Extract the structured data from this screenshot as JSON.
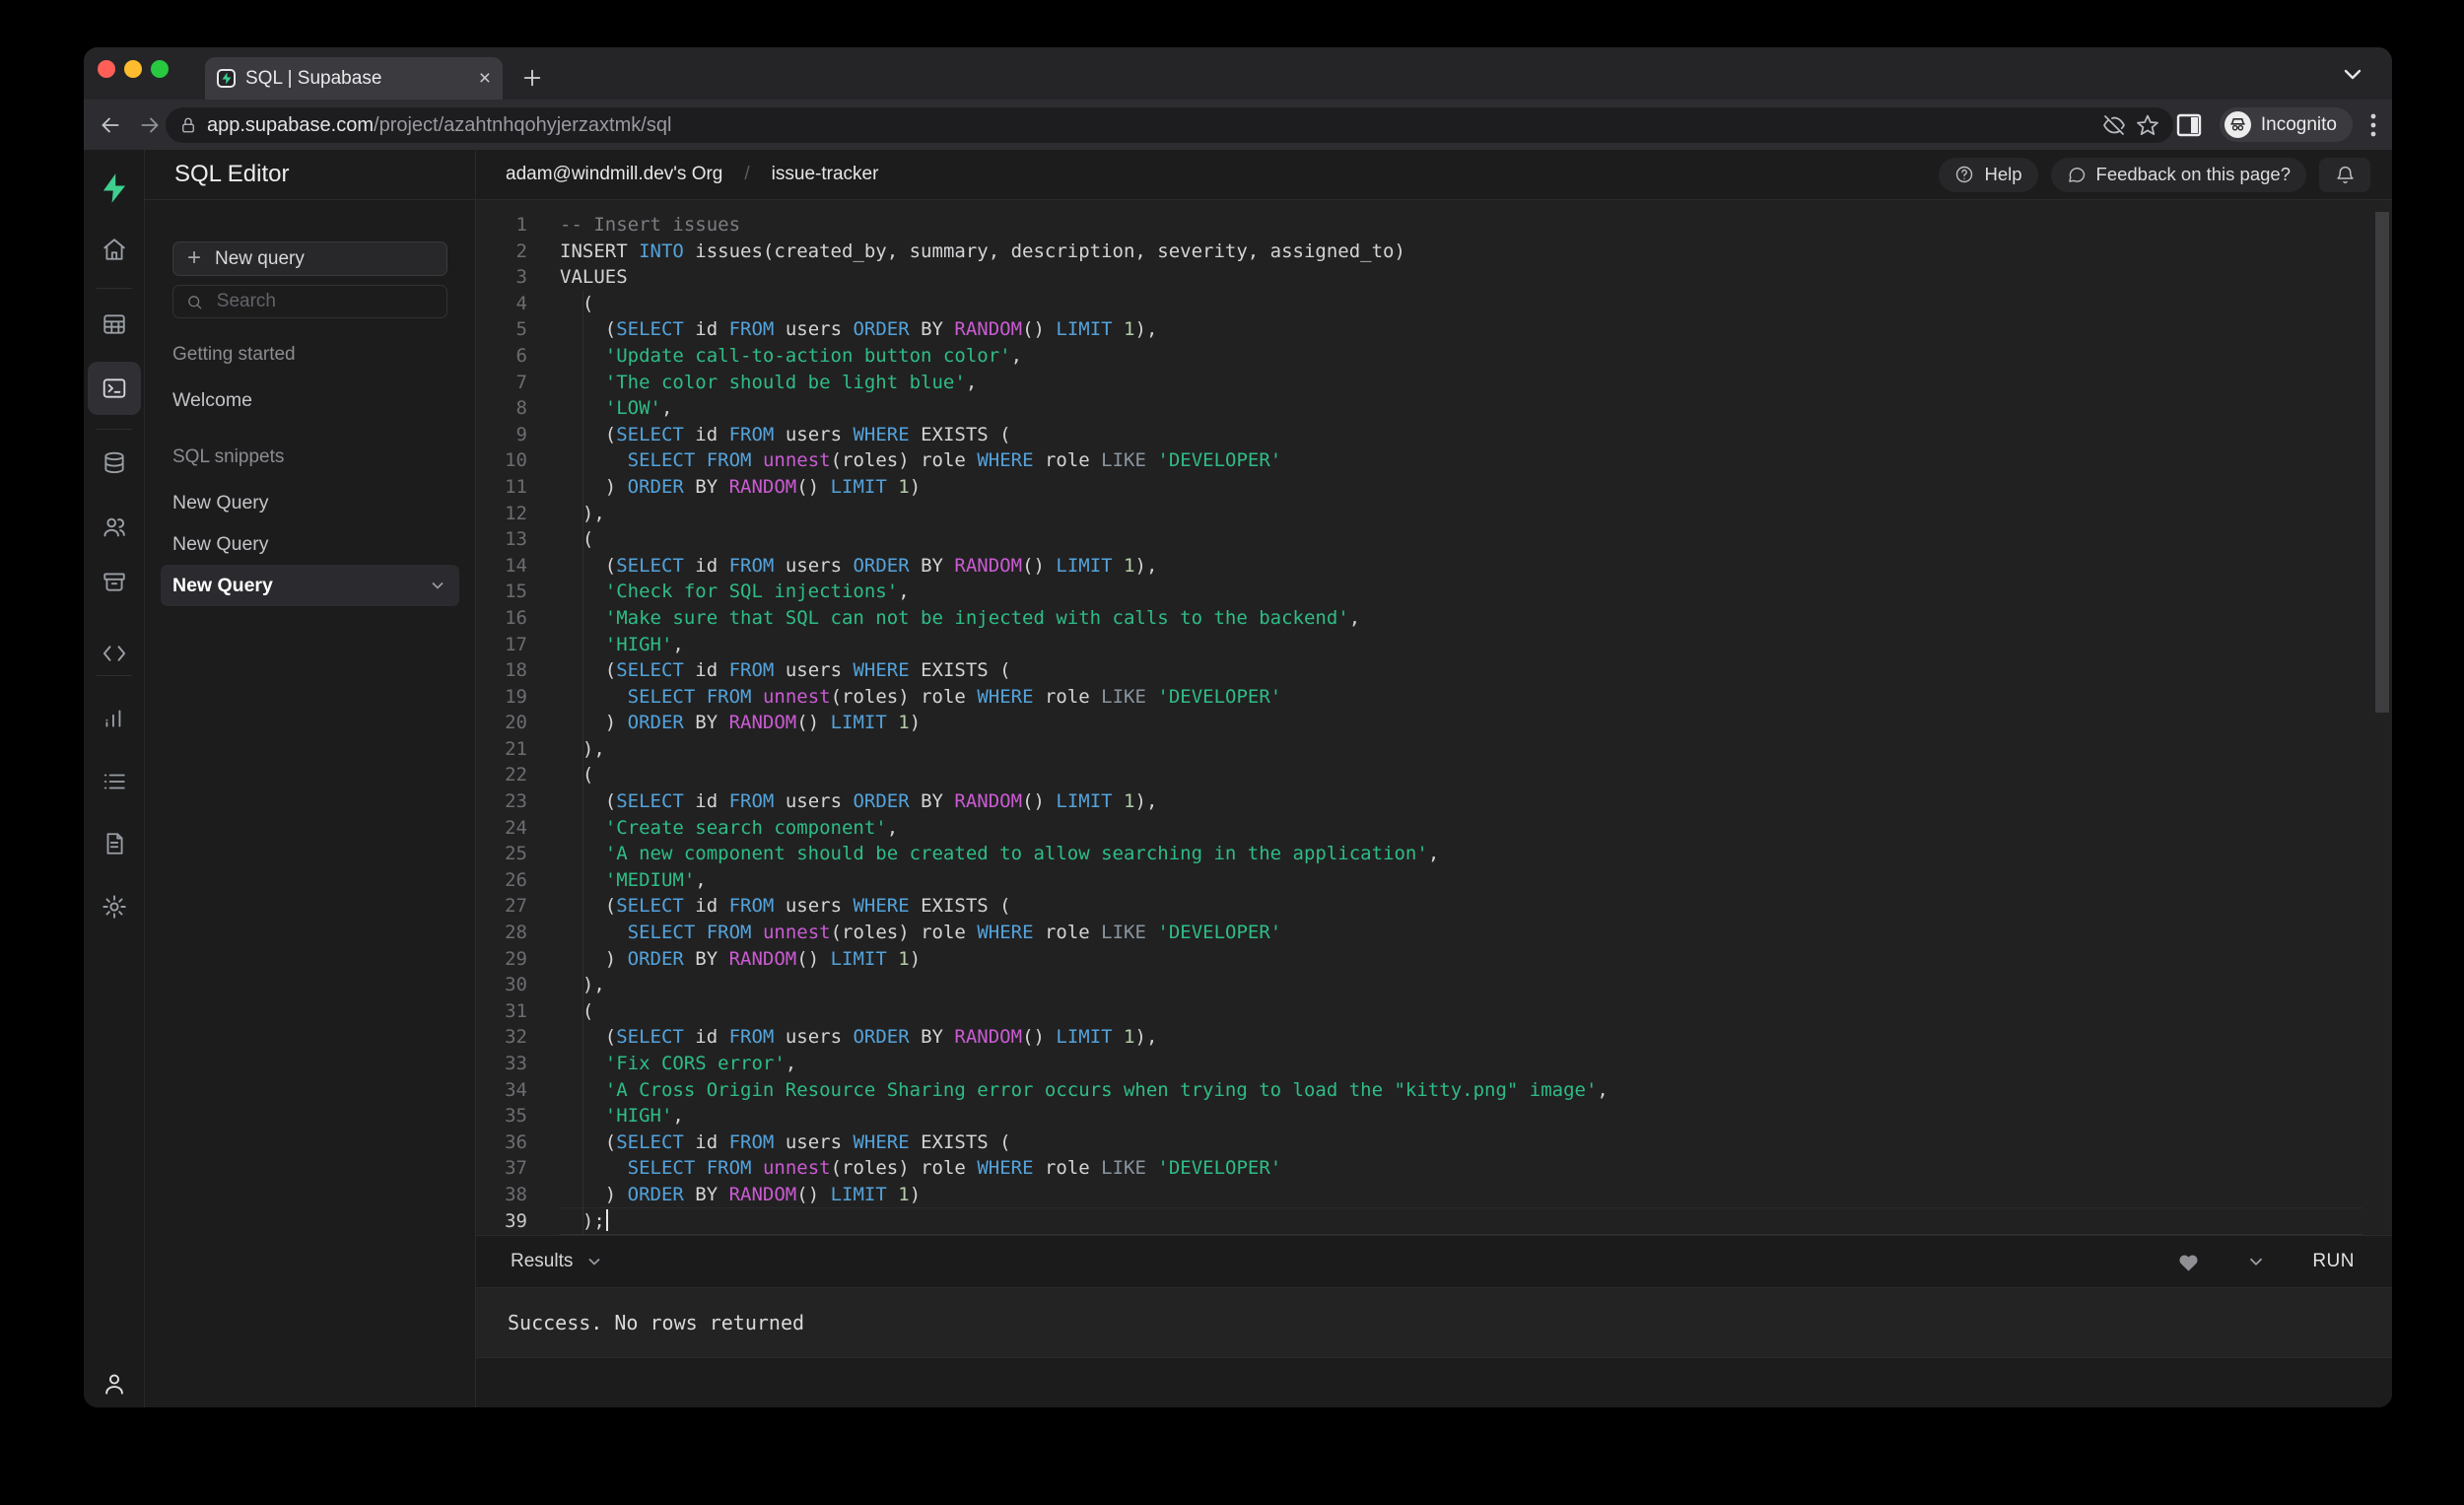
{
  "colors": {
    "accent_green": "#3ECF8E",
    "comment": "#7d7d81",
    "keyword": "#54A3DB",
    "plain": "#d4d4d6",
    "string": "#2EBD85",
    "function": "#CB5BD2",
    "operator": "#8A959E",
    "number": "#B5CEA8"
  },
  "browser": {
    "tab_title": "SQL | Supabase",
    "url_host": "app.supabase.com",
    "url_path": "/project/azahtnhqohyjerzaxtmk/sql",
    "incognito_label": "Incognito"
  },
  "topbar": {
    "breadcrumb_org": "adam@windmill.dev's Org",
    "breadcrumb_sep": "/",
    "breadcrumb_project": "issue-tracker",
    "help_label": "Help",
    "feedback_label": "Feedback on this page?"
  },
  "sidebar": {
    "title": "SQL Editor",
    "new_query_button": "New query",
    "search_placeholder": "Search",
    "sections": [
      {
        "label": "Getting started",
        "items": [
          {
            "label": "Welcome",
            "active": false
          }
        ]
      },
      {
        "label": "SQL snippets",
        "items": [
          {
            "label": "New Query",
            "active": false
          },
          {
            "label": "New Query",
            "active": false
          },
          {
            "label": "New Query",
            "active": true
          }
        ]
      }
    ]
  },
  "results": {
    "panel_label": "Results",
    "run_label": "RUN",
    "message": "Success. No rows returned"
  },
  "editor": {
    "lines": [
      {
        "n": 1,
        "t": [
          [
            "c",
            "-- Insert issues"
          ]
        ]
      },
      {
        "n": 2,
        "t": [
          [
            "p",
            "INSERT "
          ],
          [
            "k",
            "INTO"
          ],
          [
            "p",
            " issues(created_by, summary, description, severity, assigned_to)"
          ]
        ]
      },
      {
        "n": 3,
        "t": [
          [
            "p",
            "VALUES"
          ]
        ]
      },
      {
        "n": 4,
        "t": [
          [
            "p",
            "  ("
          ]
        ]
      },
      {
        "n": 5,
        "t": [
          [
            "p",
            "    ("
          ],
          [
            "k",
            "SELECT"
          ],
          [
            "p",
            " id "
          ],
          [
            "k",
            "FROM"
          ],
          [
            "p",
            " users "
          ],
          [
            "k",
            "ORDER"
          ],
          [
            "p",
            " BY "
          ],
          [
            "f",
            "RANDOM"
          ],
          [
            "p",
            "() "
          ],
          [
            "k",
            "LIMIT"
          ],
          [
            "p",
            " "
          ],
          [
            "n",
            "1"
          ],
          [
            "p",
            "),"
          ]
        ]
      },
      {
        "n": 6,
        "t": [
          [
            "p",
            "    "
          ],
          [
            "s",
            "'Update call-to-action button color'"
          ],
          [
            "p",
            ","
          ]
        ]
      },
      {
        "n": 7,
        "t": [
          [
            "p",
            "    "
          ],
          [
            "s",
            "'The color should be light blue'"
          ],
          [
            "p",
            ","
          ]
        ]
      },
      {
        "n": 8,
        "t": [
          [
            "p",
            "    "
          ],
          [
            "s",
            "'LOW'"
          ],
          [
            "p",
            ","
          ]
        ]
      },
      {
        "n": 9,
        "t": [
          [
            "p",
            "    ("
          ],
          [
            "k",
            "SELECT"
          ],
          [
            "p",
            " id "
          ],
          [
            "k",
            "FROM"
          ],
          [
            "p",
            " users "
          ],
          [
            "k",
            "WHERE"
          ],
          [
            "p",
            " EXISTS ("
          ]
        ]
      },
      {
        "n": 10,
        "t": [
          [
            "p",
            "      "
          ],
          [
            "k",
            "SELECT"
          ],
          [
            "p",
            " "
          ],
          [
            "k",
            "FROM"
          ],
          [
            "p",
            " "
          ],
          [
            "f",
            "unnest"
          ],
          [
            "p",
            "(roles) role "
          ],
          [
            "k",
            "WHERE"
          ],
          [
            "p",
            " role "
          ],
          [
            "o",
            "LIKE"
          ],
          [
            "p",
            " "
          ],
          [
            "s",
            "'DEVELOPER'"
          ]
        ]
      },
      {
        "n": 11,
        "t": [
          [
            "p",
            "    ) "
          ],
          [
            "k",
            "ORDER"
          ],
          [
            "p",
            " BY "
          ],
          [
            "f",
            "RANDOM"
          ],
          [
            "p",
            "() "
          ],
          [
            "k",
            "LIMIT"
          ],
          [
            "p",
            " "
          ],
          [
            "n",
            "1"
          ],
          [
            "p",
            ")"
          ]
        ]
      },
      {
        "n": 12,
        "t": [
          [
            "p",
            "  ),"
          ]
        ]
      },
      {
        "n": 13,
        "t": [
          [
            "p",
            "  ("
          ]
        ]
      },
      {
        "n": 14,
        "t": [
          [
            "p",
            "    ("
          ],
          [
            "k",
            "SELECT"
          ],
          [
            "p",
            " id "
          ],
          [
            "k",
            "FROM"
          ],
          [
            "p",
            " users "
          ],
          [
            "k",
            "ORDER"
          ],
          [
            "p",
            " BY "
          ],
          [
            "f",
            "RANDOM"
          ],
          [
            "p",
            "() "
          ],
          [
            "k",
            "LIMIT"
          ],
          [
            "p",
            " "
          ],
          [
            "n",
            "1"
          ],
          [
            "p",
            "),"
          ]
        ]
      },
      {
        "n": 15,
        "t": [
          [
            "p",
            "    "
          ],
          [
            "s",
            "'Check for SQL injections'"
          ],
          [
            "p",
            ","
          ]
        ]
      },
      {
        "n": 16,
        "t": [
          [
            "p",
            "    "
          ],
          [
            "s",
            "'Make sure that SQL can not be injected with calls to the backend'"
          ],
          [
            "p",
            ","
          ]
        ]
      },
      {
        "n": 17,
        "t": [
          [
            "p",
            "    "
          ],
          [
            "s",
            "'HIGH'"
          ],
          [
            "p",
            ","
          ]
        ]
      },
      {
        "n": 18,
        "t": [
          [
            "p",
            "    ("
          ],
          [
            "k",
            "SELECT"
          ],
          [
            "p",
            " id "
          ],
          [
            "k",
            "FROM"
          ],
          [
            "p",
            " users "
          ],
          [
            "k",
            "WHERE"
          ],
          [
            "p",
            " EXISTS ("
          ]
        ]
      },
      {
        "n": 19,
        "t": [
          [
            "p",
            "      "
          ],
          [
            "k",
            "SELECT"
          ],
          [
            "p",
            " "
          ],
          [
            "k",
            "FROM"
          ],
          [
            "p",
            " "
          ],
          [
            "f",
            "unnest"
          ],
          [
            "p",
            "(roles) role "
          ],
          [
            "k",
            "WHERE"
          ],
          [
            "p",
            " role "
          ],
          [
            "o",
            "LIKE"
          ],
          [
            "p",
            " "
          ],
          [
            "s",
            "'DEVELOPER'"
          ]
        ]
      },
      {
        "n": 20,
        "t": [
          [
            "p",
            "    ) "
          ],
          [
            "k",
            "ORDER"
          ],
          [
            "p",
            " BY "
          ],
          [
            "f",
            "RANDOM"
          ],
          [
            "p",
            "() "
          ],
          [
            "k",
            "LIMIT"
          ],
          [
            "p",
            " "
          ],
          [
            "n",
            "1"
          ],
          [
            "p",
            ")"
          ]
        ]
      },
      {
        "n": 21,
        "t": [
          [
            "p",
            "  ),"
          ]
        ]
      },
      {
        "n": 22,
        "t": [
          [
            "p",
            "  ("
          ]
        ]
      },
      {
        "n": 23,
        "t": [
          [
            "p",
            "    ("
          ],
          [
            "k",
            "SELECT"
          ],
          [
            "p",
            " id "
          ],
          [
            "k",
            "FROM"
          ],
          [
            "p",
            " users "
          ],
          [
            "k",
            "ORDER"
          ],
          [
            "p",
            " BY "
          ],
          [
            "f",
            "RANDOM"
          ],
          [
            "p",
            "() "
          ],
          [
            "k",
            "LIMIT"
          ],
          [
            "p",
            " "
          ],
          [
            "n",
            "1"
          ],
          [
            "p",
            "),"
          ]
        ]
      },
      {
        "n": 24,
        "t": [
          [
            "p",
            "    "
          ],
          [
            "s",
            "'Create search component'"
          ],
          [
            "p",
            ","
          ]
        ]
      },
      {
        "n": 25,
        "t": [
          [
            "p",
            "    "
          ],
          [
            "s",
            "'A new component should be created to allow searching in the application'"
          ],
          [
            "p",
            ","
          ]
        ]
      },
      {
        "n": 26,
        "t": [
          [
            "p",
            "    "
          ],
          [
            "s",
            "'MEDIUM'"
          ],
          [
            "p",
            ","
          ]
        ]
      },
      {
        "n": 27,
        "t": [
          [
            "p",
            "    ("
          ],
          [
            "k",
            "SELECT"
          ],
          [
            "p",
            " id "
          ],
          [
            "k",
            "FROM"
          ],
          [
            "p",
            " users "
          ],
          [
            "k",
            "WHERE"
          ],
          [
            "p",
            " EXISTS ("
          ]
        ]
      },
      {
        "n": 28,
        "t": [
          [
            "p",
            "      "
          ],
          [
            "k",
            "SELECT"
          ],
          [
            "p",
            " "
          ],
          [
            "k",
            "FROM"
          ],
          [
            "p",
            " "
          ],
          [
            "f",
            "unnest"
          ],
          [
            "p",
            "(roles) role "
          ],
          [
            "k",
            "WHERE"
          ],
          [
            "p",
            " role "
          ],
          [
            "o",
            "LIKE"
          ],
          [
            "p",
            " "
          ],
          [
            "s",
            "'DEVELOPER'"
          ]
        ]
      },
      {
        "n": 29,
        "t": [
          [
            "p",
            "    ) "
          ],
          [
            "k",
            "ORDER"
          ],
          [
            "p",
            " BY "
          ],
          [
            "f",
            "RANDOM"
          ],
          [
            "p",
            "() "
          ],
          [
            "k",
            "LIMIT"
          ],
          [
            "p",
            " "
          ],
          [
            "n",
            "1"
          ],
          [
            "p",
            ")"
          ]
        ]
      },
      {
        "n": 30,
        "t": [
          [
            "p",
            "  ),"
          ]
        ]
      },
      {
        "n": 31,
        "t": [
          [
            "p",
            "  ("
          ]
        ]
      },
      {
        "n": 32,
        "t": [
          [
            "p",
            "    ("
          ],
          [
            "k",
            "SELECT"
          ],
          [
            "p",
            " id "
          ],
          [
            "k",
            "FROM"
          ],
          [
            "p",
            " users "
          ],
          [
            "k",
            "ORDER"
          ],
          [
            "p",
            " BY "
          ],
          [
            "f",
            "RANDOM"
          ],
          [
            "p",
            "() "
          ],
          [
            "k",
            "LIMIT"
          ],
          [
            "p",
            " "
          ],
          [
            "n",
            "1"
          ],
          [
            "p",
            "),"
          ]
        ]
      },
      {
        "n": 33,
        "t": [
          [
            "p",
            "    "
          ],
          [
            "s",
            "'Fix CORS error'"
          ],
          [
            "p",
            ","
          ]
        ]
      },
      {
        "n": 34,
        "t": [
          [
            "p",
            "    "
          ],
          [
            "s",
            "'A Cross Origin Resource Sharing error occurs when trying to load the \"kitty.png\" image'"
          ],
          [
            "p",
            ","
          ]
        ]
      },
      {
        "n": 35,
        "t": [
          [
            "p",
            "    "
          ],
          [
            "s",
            "'HIGH'"
          ],
          [
            "p",
            ","
          ]
        ]
      },
      {
        "n": 36,
        "t": [
          [
            "p",
            "    ("
          ],
          [
            "k",
            "SELECT"
          ],
          [
            "p",
            " id "
          ],
          [
            "k",
            "FROM"
          ],
          [
            "p",
            " users "
          ],
          [
            "k",
            "WHERE"
          ],
          [
            "p",
            " EXISTS ("
          ]
        ]
      },
      {
        "n": 37,
        "t": [
          [
            "p",
            "      "
          ],
          [
            "k",
            "SELECT"
          ],
          [
            "p",
            " "
          ],
          [
            "k",
            "FROM"
          ],
          [
            "p",
            " "
          ],
          [
            "f",
            "unnest"
          ],
          [
            "p",
            "(roles) role "
          ],
          [
            "k",
            "WHERE"
          ],
          [
            "p",
            " role "
          ],
          [
            "o",
            "LIKE"
          ],
          [
            "p",
            " "
          ],
          [
            "s",
            "'DEVELOPER'"
          ]
        ]
      },
      {
        "n": 38,
        "t": [
          [
            "p",
            "    ) "
          ],
          [
            "k",
            "ORDER"
          ],
          [
            "p",
            " BY "
          ],
          [
            "f",
            "RANDOM"
          ],
          [
            "p",
            "() "
          ],
          [
            "k",
            "LIMIT"
          ],
          [
            "p",
            " "
          ],
          [
            "n",
            "1"
          ],
          [
            "p",
            ")"
          ]
        ]
      },
      {
        "n": 39,
        "t": [
          [
            "p",
            "  );"
          ]
        ],
        "active": true,
        "cursor": true
      }
    ]
  }
}
